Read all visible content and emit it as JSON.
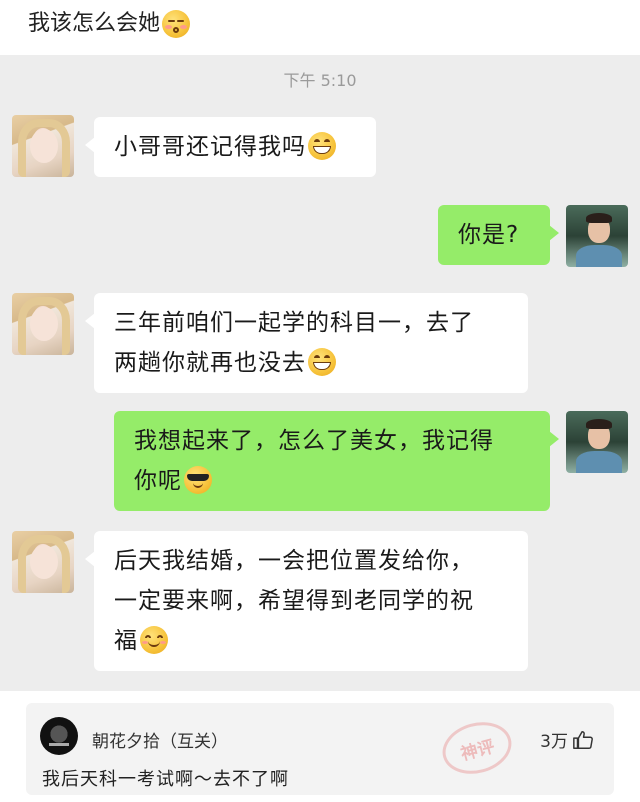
{
  "post": {
    "title": "我该怎么会她",
    "title_emoji": "kissing-face-emoji"
  },
  "chat": {
    "time": "下午 5:10",
    "messages": [
      {
        "sender": "her",
        "text": "小哥哥还记得我吗",
        "emoji": "grin-emoji"
      },
      {
        "sender": "him",
        "text": "你是?",
        "emoji": ""
      },
      {
        "sender": "her",
        "line1": "三年前咱们一起学的科目一，去了",
        "line2": "两趟你就再也没去",
        "emoji": "grin-emoji"
      },
      {
        "sender": "him",
        "line1": "我想起来了，怎么了美女，我记得",
        "line2": "你呢",
        "emoji": "sunglasses-emoji"
      },
      {
        "sender": "her",
        "line1": "后天我结婚，一会把位置发给你，",
        "line2": "一定要来啊，希望得到老同学的祝",
        "line3": "福",
        "emoji": "smiling-face-emoji"
      }
    ],
    "colors": {
      "background": "#ededed",
      "bubble_right": "#95ec69",
      "bubble_left": "#ffffff"
    }
  },
  "comment": {
    "username": "朝花夕拾（互关）",
    "likes": "3万",
    "text": "我后天科一考试啊～去不了啊",
    "stamp_text": "神评"
  }
}
